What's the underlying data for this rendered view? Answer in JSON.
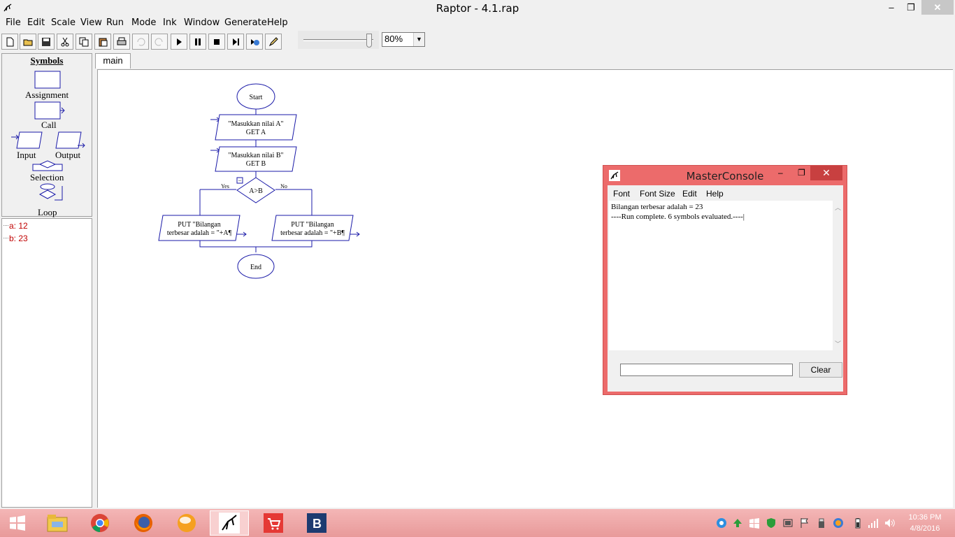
{
  "window": {
    "title": "Raptor - 4.1.rap",
    "minimize": "–",
    "maximize": "❐",
    "close": "✕"
  },
  "menu": [
    "File",
    "Edit",
    "Scale",
    "View",
    "Run",
    "Mode",
    "Ink",
    "Window",
    "Generate",
    "Help"
  ],
  "toolbar": {
    "icons": [
      "new-file-icon",
      "open-folder-icon",
      "save-icon",
      "cut-icon",
      "copy-icon",
      "paste-icon",
      "print-icon",
      "undo-icon",
      "redo-icon",
      "play-icon",
      "pause-icon",
      "stop-icon",
      "step-icon",
      "test-server-icon",
      "pen-ink-icon"
    ],
    "zoom": "80%"
  },
  "symbols": {
    "header": "Symbols",
    "items": [
      "Assignment",
      "Call",
      "Input",
      "Output",
      "Selection",
      "Loop"
    ]
  },
  "variables": [
    {
      "label": "a: 12"
    },
    {
      "label": "b: 23"
    }
  ],
  "tabs": [
    "main"
  ],
  "flowchart": {
    "start": "Start",
    "input1_line1": "\"Masukkan nilai A\"",
    "input1_line2": "GET A",
    "input2_line1": "\"Masukkan nilai B\"",
    "input2_line2": "GET B",
    "condition": "A>B",
    "yes": "Yes",
    "no": "No",
    "out_yes_line1": "PUT \"Bilangan",
    "out_yes_line2": "terbesar adalah = \"+A¶",
    "out_no_line1": "PUT \"Bilangan",
    "out_no_line2": "terbesar adalah = \"+B¶",
    "end": "End",
    "collapse": "−"
  },
  "console": {
    "title": "MasterConsole",
    "menu": [
      "Font",
      "Font Size",
      "Edit",
      "Help"
    ],
    "lines": [
      "Bilangan terbesar adalah = 23",
      "----Run complete.  6 symbols evaluated.----|"
    ],
    "input_value": "",
    "clear_label": "Clear",
    "minimize": "–",
    "maximize": "❐",
    "close": "✕"
  },
  "taskbar": {
    "apps": [
      "file-explorer-icon",
      "chrome-icon",
      "firefox-icon",
      "media-player-icon",
      "raptor-icon",
      "shopping-cart-icon",
      "bukalapak-icon"
    ],
    "tray": [
      "network-globe-icon",
      "download-manager-icon",
      "windows-icon",
      "shield-icon",
      "window-switcher-icon",
      "flag-icon",
      "usb-icon",
      "browser-tray-icon",
      "battery-icon",
      "signal-icon",
      "volume-icon"
    ],
    "time": "10:36 PM",
    "date": "4/8/2016"
  },
  "colors": {
    "flow": "#1a1aa8",
    "console_frame": "#ec6b6b",
    "variable_text": "#c00000"
  }
}
